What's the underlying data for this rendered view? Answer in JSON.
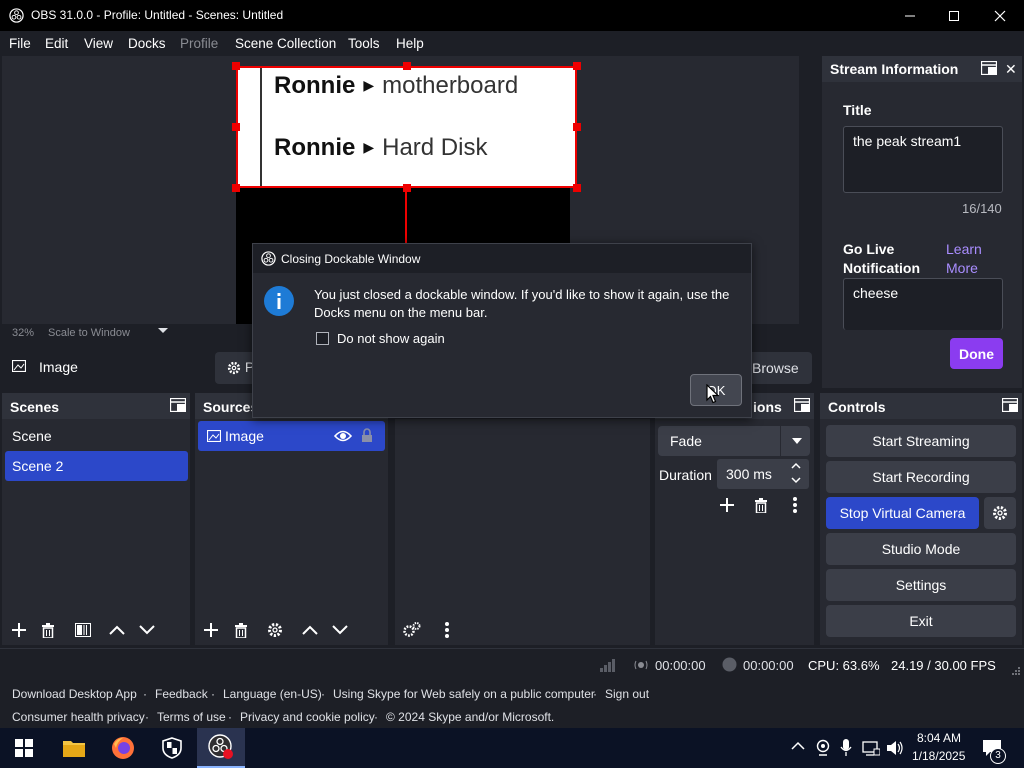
{
  "window": {
    "title": "OBS 31.0.0 - Profile: Untitled - Scenes: Untitled"
  },
  "menu": [
    "File",
    "Edit",
    "View",
    "Docks",
    "Profile",
    "Scene Collection",
    "Tools",
    "Help"
  ],
  "preview": {
    "rows": [
      {
        "user": "Ronnie",
        "leaf": "motherboard"
      },
      {
        "user": "Ronnie",
        "leaf": "Hard Disk"
      }
    ],
    "zoom": "32%",
    "scale_mode": "Scale to Window"
  },
  "source_toolbar": {
    "selected_source": "Image",
    "properties_partial": "P",
    "browse": "Browse"
  },
  "panels": {
    "scenes": {
      "header": "Scenes",
      "items": [
        "Scene",
        "Scene 2"
      ],
      "selected": 1
    },
    "sources": {
      "header": "Sources",
      "items": [
        {
          "name": "Image",
          "visible": true,
          "locked": true
        }
      ]
    },
    "transitions": {
      "header_partial": "ions",
      "type": "Fade",
      "duration_label": "Duration",
      "duration": "300 ms"
    },
    "controls": {
      "header": "Controls",
      "buttons": [
        "Start Streaming",
        "Start Recording",
        "Stop Virtual Camera",
        "Studio Mode",
        "Settings",
        "Exit"
      ]
    }
  },
  "stream_info": {
    "header": "Stream Information",
    "title_label": "Title",
    "title_value": "the peak stream1",
    "char_count": "16/140",
    "notif_label": "Go Live Notification",
    "learn_more": "Learn More",
    "notif_value": "cheese",
    "done": "Done"
  },
  "status": {
    "stream_time": "00:00:00",
    "rec_time": "00:00:00",
    "cpu": "CPU: 63.6%",
    "fps": "24.19 / 30.00 FPS"
  },
  "footer": {
    "line1": [
      "Download Desktop App",
      "Feedback",
      "Language (en-US)",
      "Using Skype for Web safely on a public computer",
      "Sign out"
    ],
    "line2": [
      "Consumer health privacy",
      "Terms of use",
      "Privacy and cookie policy",
      "© 2024 Skype and/or Microsoft."
    ],
    "separator": "·"
  },
  "dialog": {
    "title": "Closing Dockable Window",
    "message": "You just closed a dockable window. If you'd like to show it again, use the Docks menu on the menu bar.",
    "checkbox": "Do not show again",
    "ok": "OK"
  },
  "taskbar": {
    "time": "8:04 AM",
    "date": "1/18/2025",
    "notif_count": "3"
  },
  "colors": {
    "accent": "#2c48c9",
    "done": "#8b3cf0",
    "selection": "#e00000",
    "link": "#a98dff"
  }
}
